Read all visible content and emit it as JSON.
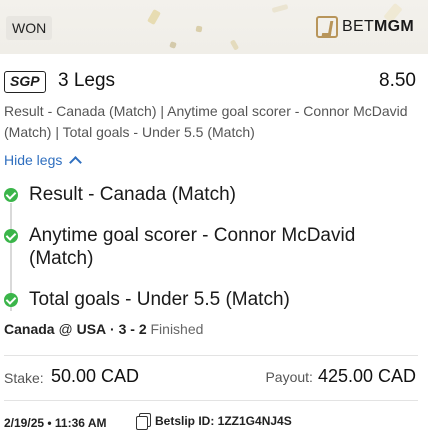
{
  "header": {
    "status_badge": "WON",
    "brand_bet": "BET",
    "brand_mgm": "MGM"
  },
  "bet": {
    "tag": "SGP",
    "legs_label": "3 Legs",
    "odds": "8.50",
    "description": "Result - Canada (Match) | Anytime goal scorer - Connor McDavid (Match) | Total goals - Under 5.5 (Match)",
    "toggle_label": "Hide legs"
  },
  "legs": [
    {
      "text": "Result - Canada (Match)",
      "status": "won"
    },
    {
      "text": "Anytime goal scorer - Connor McDavid (Match)",
      "status": "won"
    },
    {
      "text": "Total goals - Under 5.5 (Match)",
      "status": "won"
    }
  ],
  "match": {
    "home": "Canada",
    "at": "@",
    "away": "USA",
    "separator": "·",
    "score": "3 - 2",
    "status": "Finished"
  },
  "stake": {
    "label": "Stake:",
    "value": "50.00 CAD"
  },
  "payout": {
    "label": "Payout:",
    "value": "425.00 CAD"
  },
  "footer": {
    "datetime": "2/19/25 • 11:36 AM",
    "betslip_id": "Betslip ID: 1ZZ1G4NJ4S"
  },
  "colors": {
    "accent_link": "#2f6fbf",
    "won_green": "#3bb54a",
    "brand_gold": "#b8955a"
  }
}
